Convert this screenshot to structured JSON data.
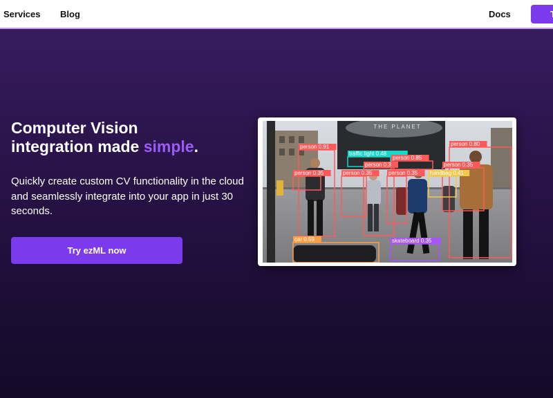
{
  "nav": {
    "links": [
      {
        "label": "Services"
      },
      {
        "label": "Blog"
      },
      {
        "label": "Docs"
      }
    ],
    "cta_label": "T"
  },
  "hero": {
    "title_line1": "Computer Vision",
    "title_line2_prefix": "integration made ",
    "title_accent": "simple",
    "title_suffix": ".",
    "subtitle": "Quickly create custom CV functionality in the cloud and seamlessly integrate into your app in just 30 seconds.",
    "cta_label": "Try ezML now"
  },
  "demo": {
    "sign_text": "THE PLANET",
    "detections": [
      {
        "label": "person 0.91",
        "color": "#ff5a5a"
      },
      {
        "label": "traffic light 0.48",
        "color": "#19d6c8"
      },
      {
        "label": "person 0.85",
        "color": "#ff5a5a"
      },
      {
        "label": "person 0.80",
        "color": "#ff5a5a"
      },
      {
        "label": "person 0.35",
        "color": "#ff5a5a"
      },
      {
        "label": "person 0.3",
        "color": "#ff5a5a"
      },
      {
        "label": "person 0.35",
        "color": "#ff5a5a"
      },
      {
        "label": "person 0.35",
        "color": "#ff5a5a"
      },
      {
        "label": "person 0.35",
        "color": "#ff5a5a"
      },
      {
        "label": "handbag 0.41",
        "color": "#f2c94c"
      },
      {
        "label": "car 0.59",
        "color": "#ff9f43"
      },
      {
        "label": "skateboard 0.35",
        "color": "#a855f7"
      }
    ]
  },
  "colors": {
    "accent": "#7c3aed",
    "accent_text": "#9b5cf6",
    "nav_bg": "#ffffff",
    "bg_top": "#3b1e62",
    "bg_bottom": "#150a28"
  }
}
